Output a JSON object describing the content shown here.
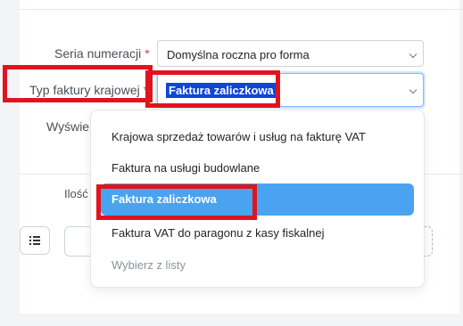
{
  "form": {
    "numbering_series": {
      "label": "Seria numeracji",
      "required_mark": "*",
      "value": "Domyślna roczna pro forma"
    },
    "invoice_type": {
      "label": "Typ faktury krajowej",
      "required_mark": "*",
      "value": "Faktura zaliczkowa"
    },
    "display_label_partial": "Wyświe",
    "quantity_header": "Ilość"
  },
  "dropdown": {
    "options": [
      {
        "label": "Krajowa sprzedaż towarów i usług na fakturę VAT"
      },
      {
        "label": "Faktura na usługi budowlane"
      },
      {
        "label": "Faktura zaliczkowa"
      },
      {
        "label": "Faktura VAT do paragonu z kasy fiskalnej"
      },
      {
        "label": "Wybierz z listy"
      }
    ],
    "selected_index": 2
  },
  "icons": {
    "list_button": "list-icon",
    "chevron": "chevron-down-icon"
  },
  "colors": {
    "highlight_box": "#e0141e",
    "selected_option_bg": "#4aa3f0",
    "text_selection_bg": "#0d47d6",
    "required": "#dc3545"
  }
}
